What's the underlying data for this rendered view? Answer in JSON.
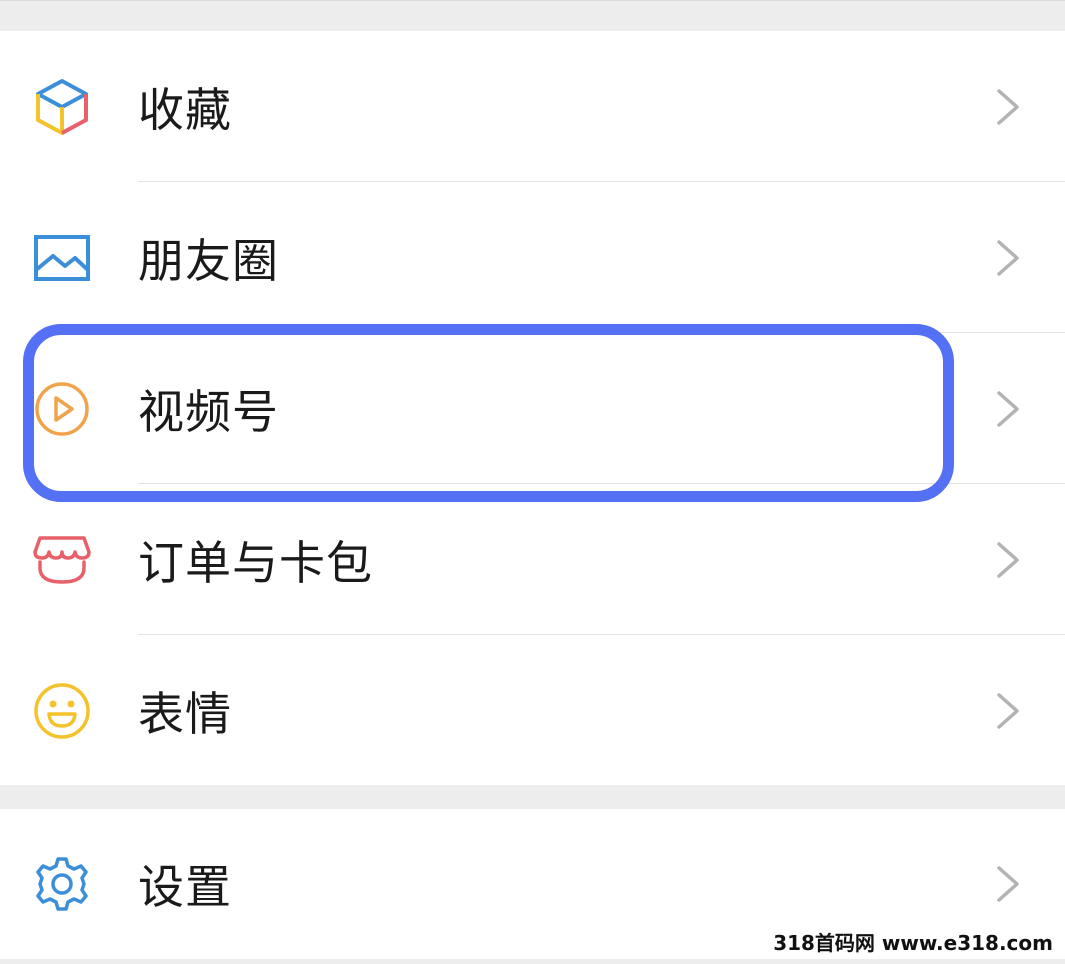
{
  "menu_group_1": [
    {
      "label": "收藏",
      "icon": "favorites-cube-icon"
    },
    {
      "label": "朋友圈",
      "icon": "moments-picture-icon"
    },
    {
      "label": "视频号",
      "icon": "channels-play-icon"
    },
    {
      "label": "订单与卡包",
      "icon": "orders-shop-icon"
    },
    {
      "label": "表情",
      "icon": "sticker-smiley-icon"
    }
  ],
  "menu_group_2": [
    {
      "label": "设置",
      "icon": "settings-gear-icon"
    }
  ],
  "highlighted_item": "视频号",
  "highlight_color": "#5470f5",
  "watermark": "318首码网 www.e318.com"
}
